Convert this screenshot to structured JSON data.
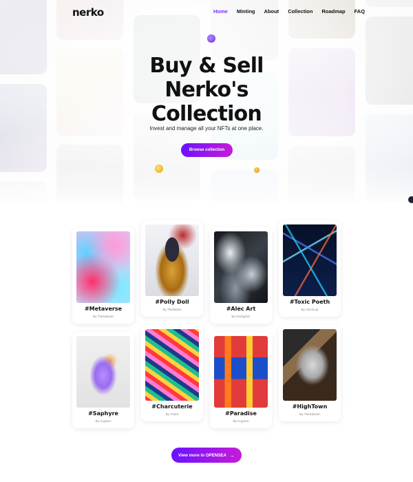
{
  "brand": {
    "logo": "nerko"
  },
  "nav": {
    "items": [
      "Home",
      "Minting",
      "About",
      "Collection",
      "Roadmap",
      "FAQ"
    ],
    "active": "Home"
  },
  "hero": {
    "headline": [
      "Buy & Sell",
      "Nerko's",
      "Collection"
    ],
    "subline": "Invest and manage all your NFTs at one place.",
    "cta": "Browse collection"
  },
  "collection": {
    "cards": [
      {
        "title": "#Metaverse",
        "by": "By TheSalvare",
        "colors": [
          "#ff7eb3",
          "#67d4ff",
          "#ff3b6b",
          "#f7c8ff"
        ]
      },
      {
        "title": "#Polly Doll",
        "by": "By TheNative",
        "colors": [
          "#eef0f5",
          "#2a2a3a",
          "#d89b2a",
          "#b02828"
        ]
      },
      {
        "title": "#Alec Art",
        "by": "By GeorgZvic",
        "colors": [
          "#1a1d22",
          "#9aa5b1",
          "#e8eef3",
          "#2f3640"
        ]
      },
      {
        "title": "#Toxic Poeth",
        "by": "By YazoiLup",
        "colors": [
          "#0a1a3a",
          "#21d4fd",
          "#ff6a3d",
          "#2b5cff"
        ]
      },
      {
        "title": "#Saphyre",
        "by": "By CryptoX",
        "colors": [
          "#ececec",
          "#b98cff",
          "#f7a23b",
          "#f2f2f2"
        ]
      },
      {
        "title": "#Charcuterie",
        "by": "By Toxtra",
        "colors": [
          "#1d3a8a",
          "#ff3b3b",
          "#ffd23f",
          "#1fbf8f"
        ]
      },
      {
        "title": "#Paradise",
        "by": "By CryptoX",
        "colors": [
          "#1a4fc9",
          "#e23b3b",
          "#ffcc33",
          "#ff7b1c"
        ]
      },
      {
        "title": "#HighTown",
        "by": "By TheSalvare",
        "colors": [
          "#2b2b2b",
          "#c9c9c9",
          "#8a6b4a",
          "#3a2a1e"
        ]
      }
    ]
  },
  "opensea": {
    "label": "View more in OPENSEA",
    "arrow": "→"
  },
  "accent": {
    "primary": "#6a11ff",
    "secondary": "#c51cd8"
  }
}
